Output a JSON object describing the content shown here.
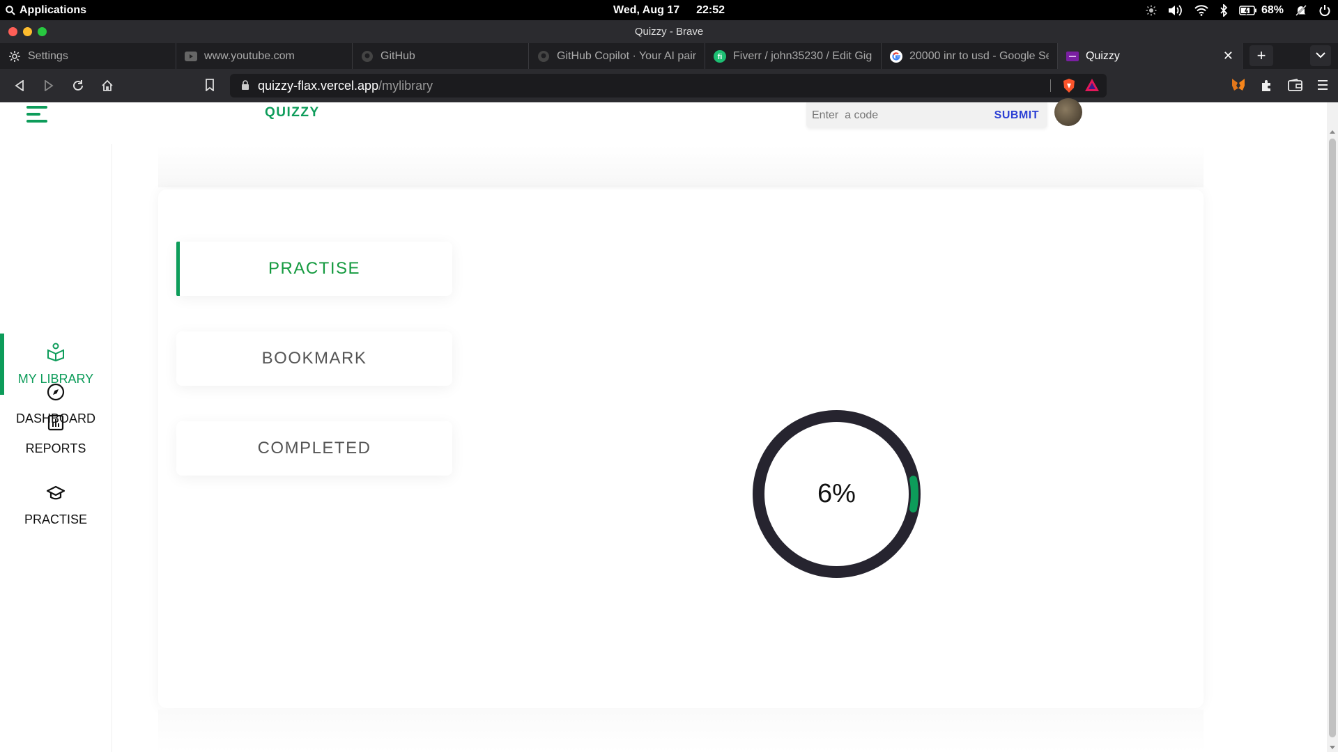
{
  "os": {
    "app_menu": "Applications",
    "date": "Wed, Aug 17",
    "time": "22:52",
    "battery": "68%"
  },
  "window": {
    "title": "Quizzy - Brave"
  },
  "tabs": [
    {
      "label": "Settings",
      "icon": "gear-icon"
    },
    {
      "label": "www.youtube.com",
      "icon": "youtube-icon"
    },
    {
      "label": "GitHub",
      "icon": "github-icon"
    },
    {
      "label": "GitHub Copilot · Your AI pair p",
      "icon": "github-icon"
    },
    {
      "label": "Fiverr / john35230 / Edit Gig",
      "icon": "fiverr-icon"
    },
    {
      "label": "20000 inr to usd - Google Se",
      "icon": "google-icon"
    },
    {
      "label": "Quizzy",
      "icon": "quizzy-icon"
    }
  ],
  "address_bar": {
    "domain": "quizzy-flax.vercel.app",
    "path": "/mylibrary"
  },
  "header": {
    "brand": "QUIZZY",
    "code_placeholder": "Enter  a code",
    "submit_label": "SUBMIT"
  },
  "sidebar": {
    "items": [
      {
        "label": "DASHBOARD",
        "icon": "compass-icon"
      },
      {
        "label": "MY LIBRARY",
        "icon": "library-icon"
      },
      {
        "label": "REPORTS",
        "icon": "bar-chart-icon"
      },
      {
        "label": "PRACTISE",
        "icon": "graduation-cap-icon"
      }
    ],
    "active": "MY LIBRARY"
  },
  "library": {
    "tabs": [
      "PRACTISE",
      "BOOKMARK",
      "COMPLETED"
    ],
    "active_tab": "PRACTISE"
  },
  "progress": {
    "percent": 6,
    "label": "6%"
  },
  "colors": {
    "accent": "#0d9c5a",
    "ring_track": "#26242f",
    "submit": "#2b3fd4"
  }
}
